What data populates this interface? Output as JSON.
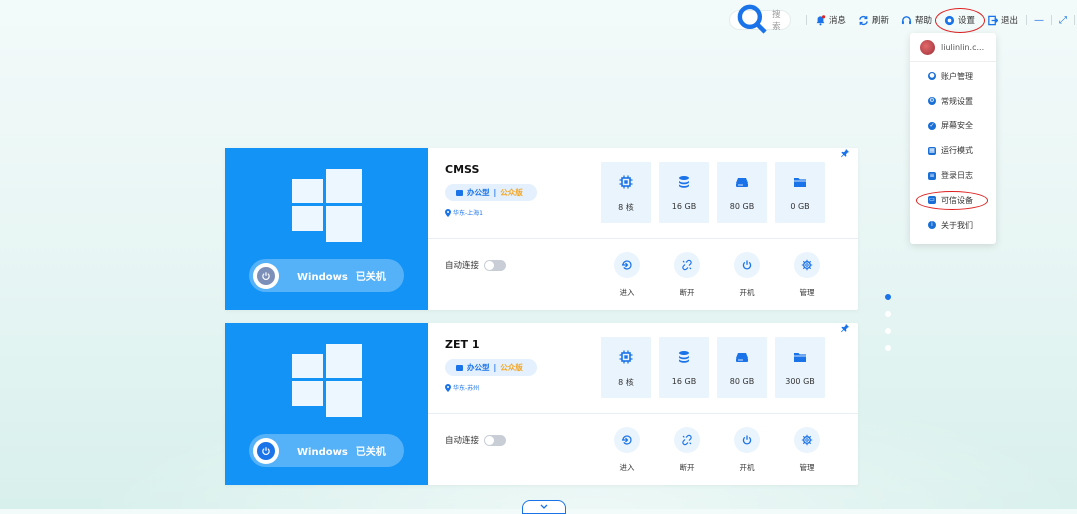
{
  "toolbar": {
    "search_placeholder": "搜索",
    "messages": "消息",
    "refresh": "刷新",
    "help": "帮助",
    "settings": "设置",
    "logout": "退出",
    "min_glyph": "—",
    "max_glyph": "⤢"
  },
  "user_menu": {
    "username": "liulinlin.c...",
    "items": [
      {
        "label": "账户管理",
        "icon": "user-icon"
      },
      {
        "label": "常规设置",
        "icon": "settings-icon"
      },
      {
        "label": "屏幕安全",
        "icon": "shield-icon"
      },
      {
        "label": "运行模式",
        "icon": "mode-icon"
      },
      {
        "label": "登录日志",
        "icon": "log-icon"
      },
      {
        "label": "可信设备",
        "icon": "device-icon"
      },
      {
        "label": "关于我们",
        "icon": "info-icon"
      }
    ]
  },
  "desktops": [
    {
      "name": "CMSS",
      "tag_a": "办公型",
      "tag_sep": "|",
      "tag_b": "公众版",
      "region": "华东-上海1",
      "os": "Windows",
      "status": "已关机",
      "cpu": "8 核",
      "memory": "16 GB",
      "disk": "80 GB",
      "data_disk": "0 GB",
      "auto_connect": "自动连接",
      "auto_connect_on": false,
      "actions": [
        "进入",
        "断开",
        "开机",
        "管理"
      ]
    },
    {
      "name": "ZET 1",
      "tag_a": "办公型",
      "tag_sep": "|",
      "tag_b": "公众版",
      "region": "华东-苏州",
      "os": "Windows",
      "status": "已关机",
      "cpu": "8 核",
      "memory": "16 GB",
      "disk": "80 GB",
      "data_disk": "300 GB",
      "auto_connect": "自动连接",
      "auto_connect_on": false,
      "actions": [
        "进入",
        "断开",
        "开机",
        "管理"
      ]
    }
  ],
  "pager": {
    "total": 4,
    "active": 1
  },
  "colors": {
    "accent": "#1a73e8",
    "card_blue": "#1493f6",
    "tag_orange": "#f5a623",
    "annotation_red": "#e02020"
  }
}
